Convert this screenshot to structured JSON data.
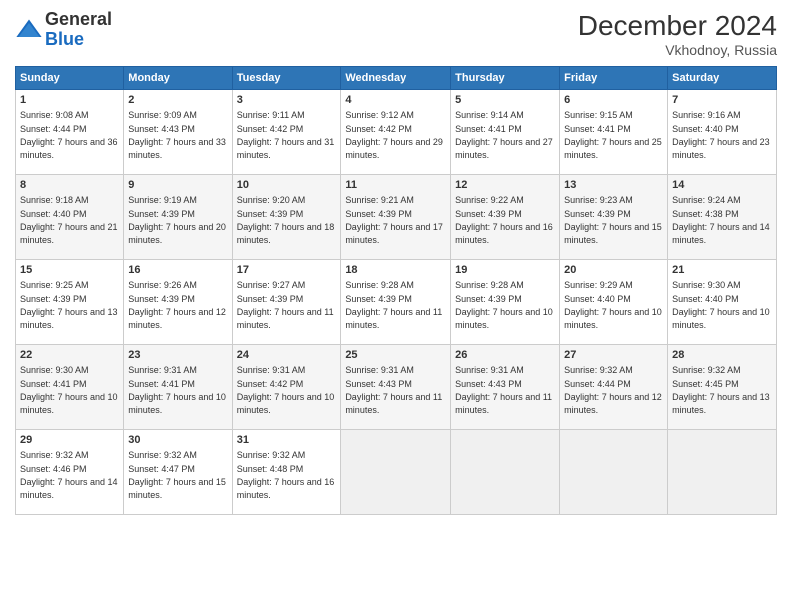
{
  "logo": {
    "general": "General",
    "blue": "Blue"
  },
  "header": {
    "month": "December 2024",
    "location": "Vkhodnoy, Russia"
  },
  "days_of_week": [
    "Sunday",
    "Monday",
    "Tuesday",
    "Wednesday",
    "Thursday",
    "Friday",
    "Saturday"
  ],
  "weeks": [
    [
      {
        "day": "1",
        "sunrise": "9:08 AM",
        "sunset": "4:44 PM",
        "daylight": "7 hours and 36 minutes."
      },
      {
        "day": "2",
        "sunrise": "9:09 AM",
        "sunset": "4:43 PM",
        "daylight": "7 hours and 33 minutes."
      },
      {
        "day": "3",
        "sunrise": "9:11 AM",
        "sunset": "4:42 PM",
        "daylight": "7 hours and 31 minutes."
      },
      {
        "day": "4",
        "sunrise": "9:12 AM",
        "sunset": "4:42 PM",
        "daylight": "7 hours and 29 minutes."
      },
      {
        "day": "5",
        "sunrise": "9:14 AM",
        "sunset": "4:41 PM",
        "daylight": "7 hours and 27 minutes."
      },
      {
        "day": "6",
        "sunrise": "9:15 AM",
        "sunset": "4:41 PM",
        "daylight": "7 hours and 25 minutes."
      },
      {
        "day": "7",
        "sunrise": "9:16 AM",
        "sunset": "4:40 PM",
        "daylight": "7 hours and 23 minutes."
      }
    ],
    [
      {
        "day": "8",
        "sunrise": "9:18 AM",
        "sunset": "4:40 PM",
        "daylight": "7 hours and 21 minutes."
      },
      {
        "day": "9",
        "sunrise": "9:19 AM",
        "sunset": "4:39 PM",
        "daylight": "7 hours and 20 minutes."
      },
      {
        "day": "10",
        "sunrise": "9:20 AM",
        "sunset": "4:39 PM",
        "daylight": "7 hours and 18 minutes."
      },
      {
        "day": "11",
        "sunrise": "9:21 AM",
        "sunset": "4:39 PM",
        "daylight": "7 hours and 17 minutes."
      },
      {
        "day": "12",
        "sunrise": "9:22 AM",
        "sunset": "4:39 PM",
        "daylight": "7 hours and 16 minutes."
      },
      {
        "day": "13",
        "sunrise": "9:23 AM",
        "sunset": "4:39 PM",
        "daylight": "7 hours and 15 minutes."
      },
      {
        "day": "14",
        "sunrise": "9:24 AM",
        "sunset": "4:38 PM",
        "daylight": "7 hours and 14 minutes."
      }
    ],
    [
      {
        "day": "15",
        "sunrise": "9:25 AM",
        "sunset": "4:39 PM",
        "daylight": "7 hours and 13 minutes."
      },
      {
        "day": "16",
        "sunrise": "9:26 AM",
        "sunset": "4:39 PM",
        "daylight": "7 hours and 12 minutes."
      },
      {
        "day": "17",
        "sunrise": "9:27 AM",
        "sunset": "4:39 PM",
        "daylight": "7 hours and 11 minutes."
      },
      {
        "day": "18",
        "sunrise": "9:28 AM",
        "sunset": "4:39 PM",
        "daylight": "7 hours and 11 minutes."
      },
      {
        "day": "19",
        "sunrise": "9:28 AM",
        "sunset": "4:39 PM",
        "daylight": "7 hours and 10 minutes."
      },
      {
        "day": "20",
        "sunrise": "9:29 AM",
        "sunset": "4:40 PM",
        "daylight": "7 hours and 10 minutes."
      },
      {
        "day": "21",
        "sunrise": "9:30 AM",
        "sunset": "4:40 PM",
        "daylight": "7 hours and 10 minutes."
      }
    ],
    [
      {
        "day": "22",
        "sunrise": "9:30 AM",
        "sunset": "4:41 PM",
        "daylight": "7 hours and 10 minutes."
      },
      {
        "day": "23",
        "sunrise": "9:31 AM",
        "sunset": "4:41 PM",
        "daylight": "7 hours and 10 minutes."
      },
      {
        "day": "24",
        "sunrise": "9:31 AM",
        "sunset": "4:42 PM",
        "daylight": "7 hours and 10 minutes."
      },
      {
        "day": "25",
        "sunrise": "9:31 AM",
        "sunset": "4:43 PM",
        "daylight": "7 hours and 11 minutes."
      },
      {
        "day": "26",
        "sunrise": "9:31 AM",
        "sunset": "4:43 PM",
        "daylight": "7 hours and 11 minutes."
      },
      {
        "day": "27",
        "sunrise": "9:32 AM",
        "sunset": "4:44 PM",
        "daylight": "7 hours and 12 minutes."
      },
      {
        "day": "28",
        "sunrise": "9:32 AM",
        "sunset": "4:45 PM",
        "daylight": "7 hours and 13 minutes."
      }
    ],
    [
      {
        "day": "29",
        "sunrise": "9:32 AM",
        "sunset": "4:46 PM",
        "daylight": "7 hours and 14 minutes."
      },
      {
        "day": "30",
        "sunrise": "9:32 AM",
        "sunset": "4:47 PM",
        "daylight": "7 hours and 15 minutes."
      },
      {
        "day": "31",
        "sunrise": "9:32 AM",
        "sunset": "4:48 PM",
        "daylight": "7 hours and 16 minutes."
      },
      null,
      null,
      null,
      null
    ]
  ]
}
